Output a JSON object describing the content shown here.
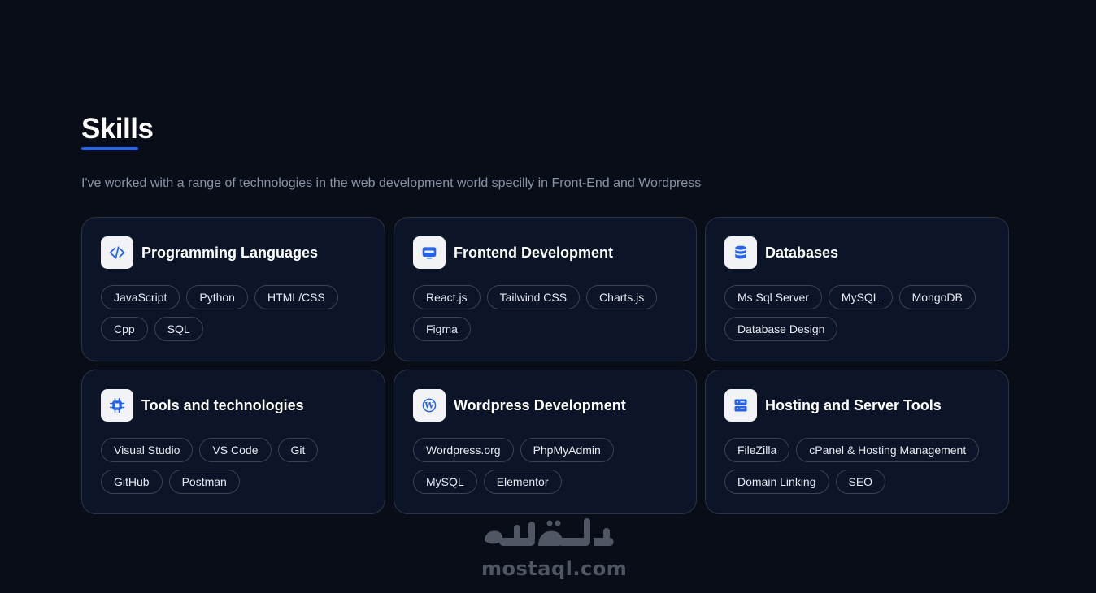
{
  "section": {
    "title": "Skills",
    "subtitle": "I've worked with a range of technologies in the web development world specilly in Front-End and Wordpress"
  },
  "colors": {
    "background": "#090d18",
    "card_background": "#0c1428",
    "accent": "#2563eb",
    "icon_background": "#f1f3f7"
  },
  "cards": [
    {
      "title": "Programming Languages",
      "icon": "code-icon",
      "tags": [
        "JavaScript",
        "Python",
        "HTML/CSS",
        "Cpp",
        "SQL"
      ]
    },
    {
      "title": "Frontend Development",
      "icon": "monitor-icon",
      "tags": [
        "React.js",
        "Tailwind CSS",
        "Charts.js",
        "Figma"
      ]
    },
    {
      "title": "Databases",
      "icon": "database-icon",
      "tags": [
        "Ms Sql Server",
        "MySQL",
        "MongoDB",
        "Database Design"
      ]
    },
    {
      "title": "Tools and technologies",
      "icon": "chip-icon",
      "tags": [
        "Visual Studio",
        "VS Code",
        "Git",
        "GitHub",
        "Postman"
      ]
    },
    {
      "title": "Wordpress Development",
      "icon": "wordpress-icon",
      "tags": [
        "Wordpress.org",
        "PhpMyAdmin",
        "MySQL",
        "Elementor"
      ]
    },
    {
      "title": "Hosting and Server Tools",
      "icon": "server-icon",
      "tags": [
        "FileZilla",
        "cPanel & Hosting Management",
        "Domain Linking",
        "SEO"
      ]
    }
  ],
  "watermark": {
    "arabic": "مستقل",
    "latin": "mostaql.com"
  }
}
